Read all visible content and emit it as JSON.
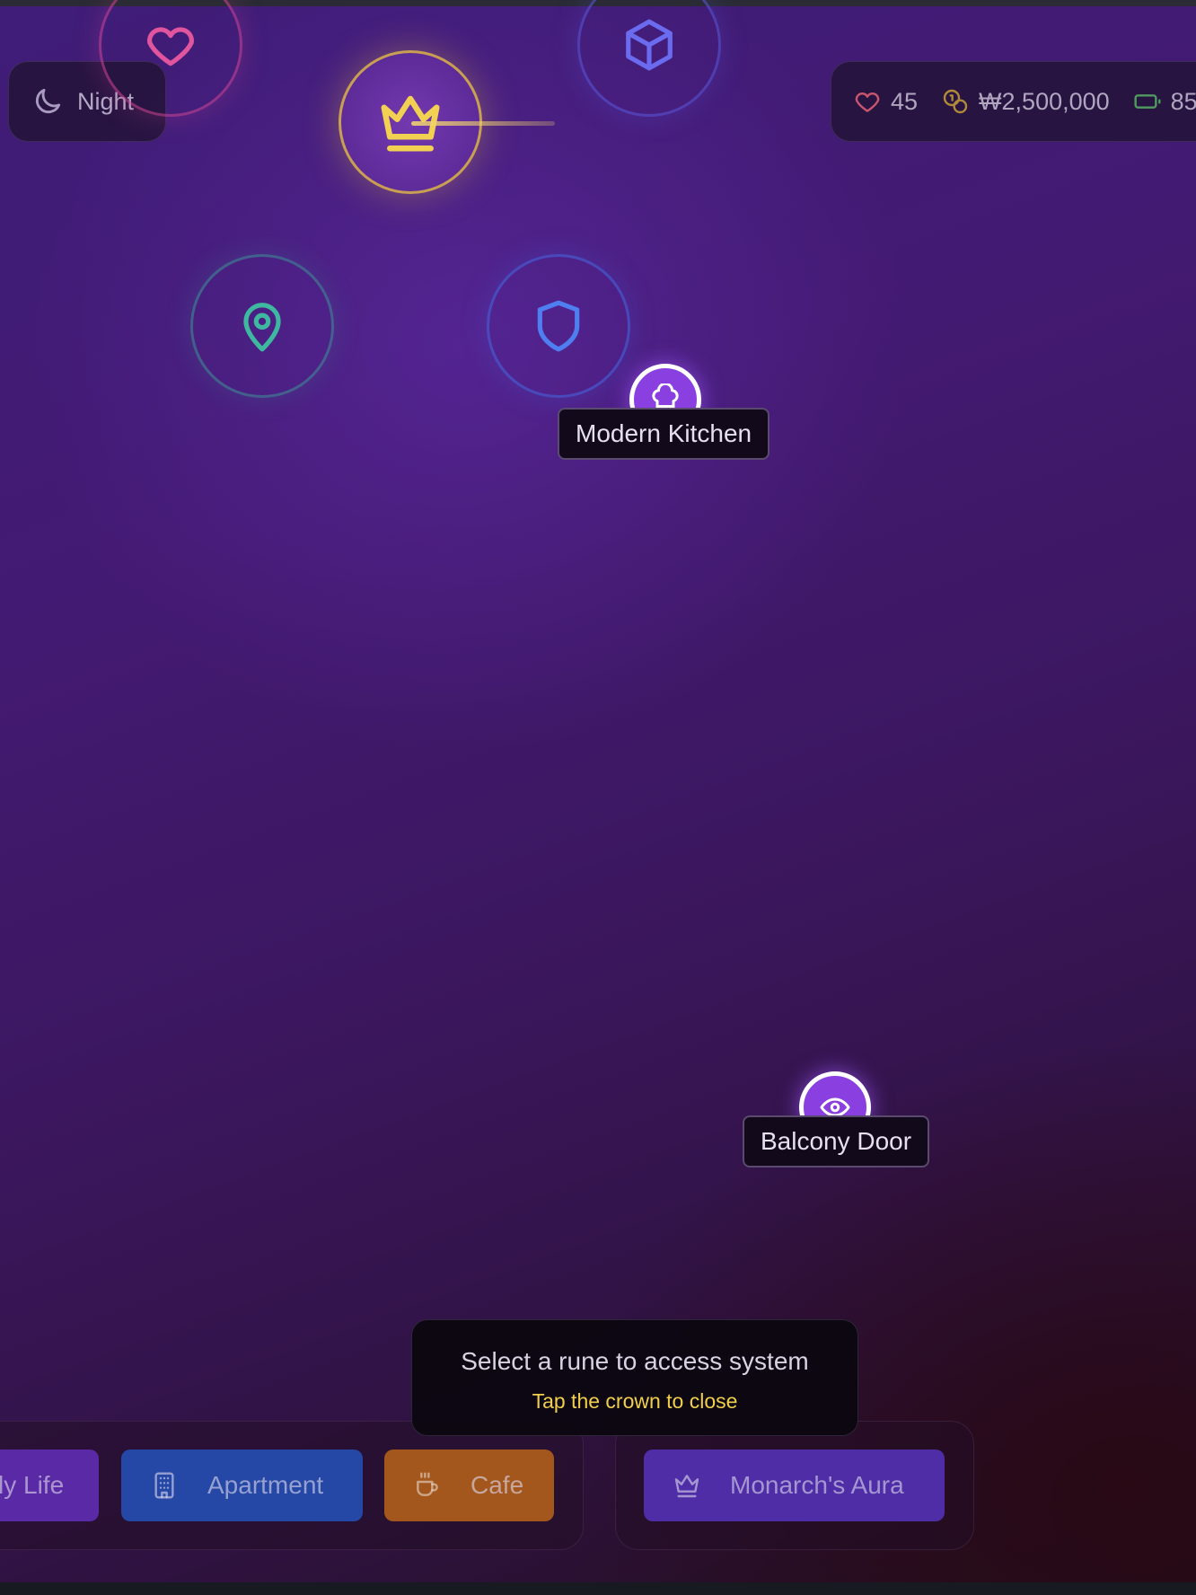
{
  "status": {
    "time_of_day": "Night",
    "affection": "45",
    "money": "₩2,500,000",
    "battery": "85"
  },
  "runes": [
    {
      "name": "heart",
      "color": "#e0559e"
    },
    {
      "name": "crown",
      "color": "#f1d052"
    },
    {
      "name": "box",
      "color": "#6b6bf0"
    },
    {
      "name": "map-pin",
      "color": "#3fb8a0"
    },
    {
      "name": "shield",
      "color": "#4f7ef0"
    }
  ],
  "hotspots": [
    {
      "label": "Modern Kitchen",
      "icon": "chef-hat-icon"
    },
    {
      "label": "Balcony Door",
      "icon": "eye-icon"
    }
  ],
  "prompt": {
    "title": "Select a rune to access system",
    "subtitle": "Tap the crown to close"
  },
  "tabs": {
    "family_life": "ly Life",
    "apartment": "Apartment",
    "cafe": "Cafe",
    "monarchs_aura": "Monarch's Aura"
  },
  "colors": {
    "accent_gold": "#f1cf4d",
    "hotspot_purple": "#8a3fe0",
    "tab_apartment": "#2548a6",
    "tab_cafe": "#a3571d",
    "tab_monarch": "#4e2da6"
  }
}
